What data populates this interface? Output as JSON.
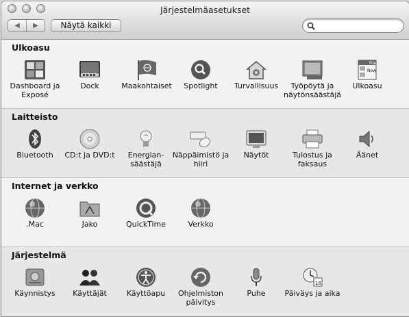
{
  "window": {
    "title": "Järjestelmäasetukset"
  },
  "toolbar": {
    "back": "◀",
    "forward": "▶",
    "show_all": "Näytä kaikki",
    "search_placeholder": ""
  },
  "sections": [
    {
      "title": "Ulkoasu",
      "items": [
        {
          "label": "Dashboard ja\nExposé",
          "icon": "dashboard-expose-icon"
        },
        {
          "label": "Dock",
          "icon": "dock-icon"
        },
        {
          "label": "Maakohtaiset",
          "icon": "international-icon"
        },
        {
          "label": "Spotlight",
          "icon": "spotlight-icon"
        },
        {
          "label": "Turvallisuus",
          "icon": "security-icon"
        },
        {
          "label": "Työpöytä ja\nnäytönsäästäjä",
          "icon": "desktop-screensaver-icon"
        },
        {
          "label": "Ulkoasu",
          "icon": "appearance-icon"
        }
      ]
    },
    {
      "title": "Laitteisto",
      "items": [
        {
          "label": "Bluetooth",
          "icon": "bluetooth-icon"
        },
        {
          "label": "CD:t ja DVD:t",
          "icon": "cd-dvd-icon"
        },
        {
          "label": "Energian-\nsäästäjä",
          "icon": "energy-saver-icon"
        },
        {
          "label": "Näppäimistö ja\nhiiri",
          "icon": "keyboard-mouse-icon"
        },
        {
          "label": "Näytöt",
          "icon": "displays-icon"
        },
        {
          "label": "Tulostus ja\nfaksaus",
          "icon": "print-fax-icon"
        },
        {
          "label": "Äänet",
          "icon": "sound-icon"
        }
      ]
    },
    {
      "title": "Internet ja verkko",
      "items": [
        {
          "label": ".Mac",
          "icon": "mac-icon"
        },
        {
          "label": "Jako",
          "icon": "sharing-icon"
        },
        {
          "label": "QuickTime",
          "icon": "quicktime-icon"
        },
        {
          "label": "Verkko",
          "icon": "network-icon"
        }
      ]
    },
    {
      "title": "Järjestelmä",
      "items": [
        {
          "label": "Käynnistys",
          "icon": "startup-disk-icon"
        },
        {
          "label": "Käyttäjät",
          "icon": "accounts-icon"
        },
        {
          "label": "Käyttöapu",
          "icon": "universal-access-icon"
        },
        {
          "label": "Ohjelmiston\npäivitys",
          "icon": "software-update-icon"
        },
        {
          "label": "Puhe",
          "icon": "speech-icon"
        },
        {
          "label": "Päiväys ja aika",
          "icon": "date-time-icon"
        }
      ]
    }
  ]
}
